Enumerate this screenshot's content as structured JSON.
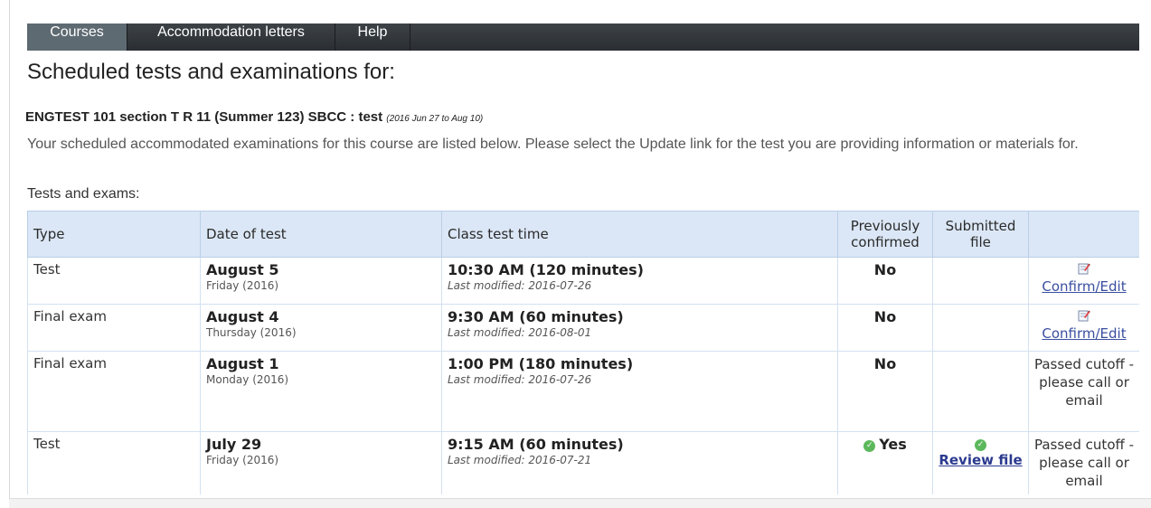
{
  "nav": {
    "items": [
      {
        "label": "Courses",
        "active": true
      },
      {
        "label": "Accommodation letters",
        "active": false
      },
      {
        "label": "Help",
        "active": false
      }
    ]
  },
  "page_title": "Scheduled tests and examinations for:",
  "course": {
    "heading": "ENGTEST 101 section T R 11 (Summer 123) SBCC : test",
    "dates": "(2016 Jun 27 to Aug 10)"
  },
  "intro_text": "Your scheduled accommodated examinations for this course are listed below. Please select the Update link for the test you are providing information or materials for.",
  "tests_label": "Tests and exams:",
  "table": {
    "headers": {
      "type": "Type",
      "date": "Date of test",
      "time": "Class test time",
      "confirmed": "Previously confirmed",
      "file": "Submitted file",
      "actions": ""
    },
    "rows": [
      {
        "type": "Test",
        "date": "August 5",
        "date_sub": "Friday (2016)",
        "time": "10:30 AM (120 minutes)",
        "modified": "Last modified: 2016-07-26",
        "confirmed": "No",
        "file": "",
        "action": "Confirm/Edit"
      },
      {
        "type": "Final exam",
        "date": "August 4",
        "date_sub": "Thursday (2016)",
        "time": "9:30 AM (60 minutes)",
        "modified": "Last modified: 2016-08-01",
        "confirmed": "No",
        "file": "",
        "action": "Confirm/Edit"
      },
      {
        "type": "Final exam",
        "date": "August 1",
        "date_sub": "Monday (2016)",
        "time": "1:00 PM (180 minutes)",
        "modified": "Last modified: 2016-07-26",
        "confirmed": "No",
        "file": "",
        "action": "Passed cutoff - please call or email"
      },
      {
        "type": "Test",
        "date": "July 29",
        "date_sub": "Friday (2016)",
        "time": "9:15 AM (60 minutes)",
        "modified": "Last modified: 2016-07-21",
        "confirmed": "Yes",
        "file": "Review file",
        "action": "Passed cutoff - please call or email"
      }
    ]
  },
  "icons": {
    "edit": "edit-icon",
    "check": "checkmark-icon"
  },
  "colors": {
    "nav_bg": "#2f3337",
    "nav_active": "#5e6a72",
    "table_header_bg": "#dbe7f6",
    "link": "#3a4fa0",
    "check_green": "#5cb85c"
  }
}
